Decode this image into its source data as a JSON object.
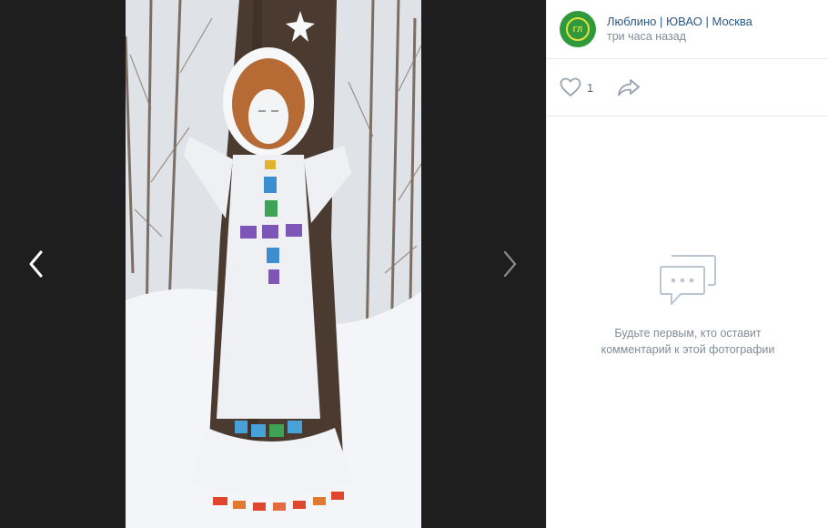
{
  "viewer": {
    "prev_icon": "chevron-left-icon",
    "next_icon": "chevron-right-icon"
  },
  "post": {
    "group_name": "Люблино | ЮВАО | Москва",
    "avatar_text": "ГЛ",
    "time": "три часа назад",
    "likes": "1",
    "like_icon": "heart-icon",
    "share_icon": "share-arrow-icon"
  },
  "comments": {
    "icon": "comments-icon",
    "empty_line1": "Будьте первым, кто оставит",
    "empty_line2": "комментарий к этой фотографии"
  },
  "colors": {
    "viewer_bg": "#1e1e1e",
    "link": "#2a5885",
    "muted": "#818c99",
    "avatar_bg": "#2f9a3c",
    "avatar_accent": "#e4e23f"
  }
}
